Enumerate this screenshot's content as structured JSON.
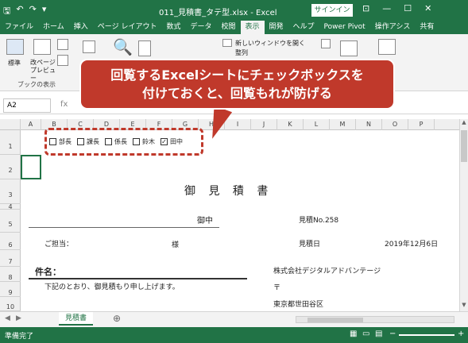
{
  "title_bar": {
    "title": "011_見積書_タテ型.xlsx - Excel",
    "signin": "サインイン",
    "qat_icons": [
      "save-icon",
      "undo-icon",
      "redo-icon",
      "customize-icon"
    ]
  },
  "tabs": [
    "ファイル",
    "ホーム",
    "挿入",
    "ページ レイアウト",
    "数式",
    "データ",
    "校閲",
    "表示",
    "開発",
    "ヘルプ",
    "Power Pivot",
    "操作アシス",
    "共有"
  ],
  "active_tab": "表示",
  "ribbon": {
    "normal": "標準",
    "page_break": "改ページ\nプレビュー",
    "group_label": "ブックの表示",
    "new_window": "新しいウィンドウを開く",
    "arrange": "整列"
  },
  "formula_bar": {
    "name_box": "A2",
    "fx": "fx"
  },
  "columns": [
    "A",
    "B",
    "C",
    "D",
    "E",
    "F",
    "G",
    "H",
    "I",
    "J",
    "K",
    "L",
    "M",
    "N",
    "O",
    "P"
  ],
  "rows": [
    "1",
    "2",
    "3",
    "4",
    "5",
    "6",
    "7",
    "8",
    "9",
    "10"
  ],
  "checkboxes": [
    {
      "label": "部長",
      "checked": false
    },
    {
      "label": "課長",
      "checked": false
    },
    {
      "label": "係長",
      "checked": false
    },
    {
      "label": "鈴木",
      "checked": false
    },
    {
      "label": "田中",
      "checked": true
    }
  ],
  "sheet": {
    "doc_title": "御 見 積 書",
    "to": "御中",
    "estimate_no": "見積No.258",
    "contact": "ご担当：",
    "sama": "様",
    "date_label": "見積日",
    "date_value": "2019年12月6日",
    "subject": "件名：",
    "company": "株式会社デジタルアドバンテージ",
    "note": "下記のとおり、御見積もり申し上げます。",
    "postal": "〒",
    "address": "東京都世田谷区"
  },
  "sheet_tab": "見積書",
  "status": "準備完了",
  "callout": {
    "line1": "回覧するExcelシートにチェックボックスを",
    "line2": "付けておくと、回覧もれが防げる"
  }
}
